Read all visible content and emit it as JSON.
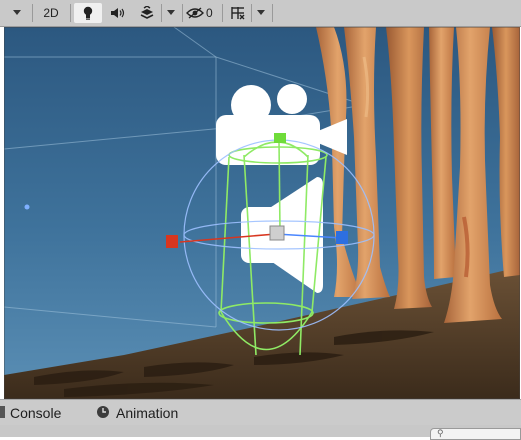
{
  "toolbar": {
    "mode_2d_label": "2D",
    "hidden_count": "0",
    "icons": [
      "dropdown-icon",
      "lightbulb-icon",
      "audio-icon",
      "effects-icon",
      "dropdown-icon",
      "visibility-icon",
      "gizmos-icon",
      "dropdown-icon"
    ]
  },
  "bottom_tabs": [
    {
      "label": "Console",
      "icon": "console-icon"
    },
    {
      "label": "Animation",
      "icon": "animation-clock-icon"
    }
  ],
  "colors": {
    "toolbar_bg": "#c9c9c9",
    "sky_top": "#2f5f86",
    "sky_bottom": "#4b7ea5",
    "ground": "#4a3723",
    "gizmo_green": "#7ee05b",
    "axis_red": "#d8361f",
    "axis_blue": "#2d6fe0",
    "trunk": "#d7925a"
  }
}
